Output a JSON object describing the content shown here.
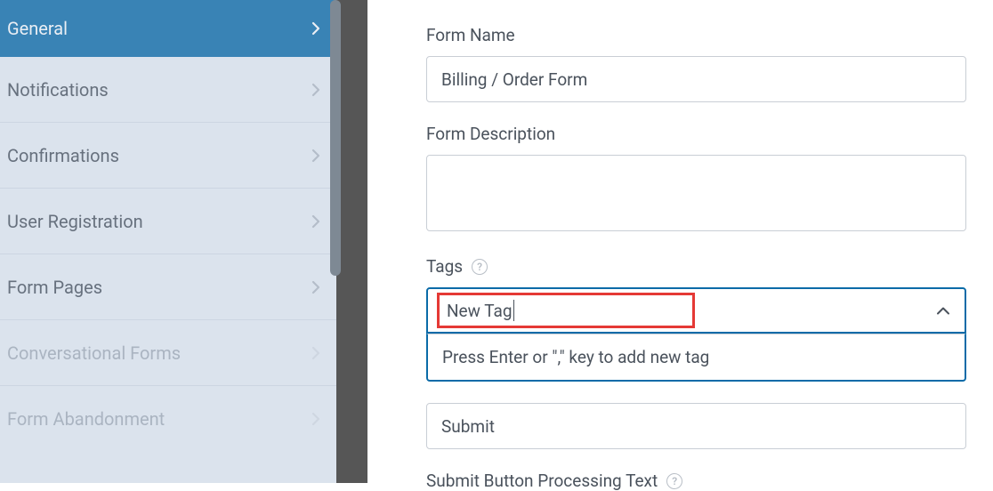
{
  "sidebar": {
    "items": [
      {
        "label": "General",
        "state": "active"
      },
      {
        "label": "Notifications",
        "state": "normal"
      },
      {
        "label": "Confirmations",
        "state": "normal"
      },
      {
        "label": "User Registration",
        "state": "normal"
      },
      {
        "label": "Form Pages",
        "state": "normal"
      },
      {
        "label": "Conversational Forms",
        "state": "disabled"
      },
      {
        "label": "Form Abandonment",
        "state": "disabled"
      }
    ]
  },
  "form": {
    "form_name_label": "Form Name",
    "form_name_value": "Billing / Order Form",
    "form_description_label": "Form Description",
    "form_description_value": "",
    "tags_label": "Tags",
    "tags_input_value": "New Tag",
    "tags_dropdown_hint": "Press Enter or \",\" key to add new tag",
    "submit_button_text_value": "Submit",
    "submit_button_processing_label": "Submit Button Processing Text"
  }
}
